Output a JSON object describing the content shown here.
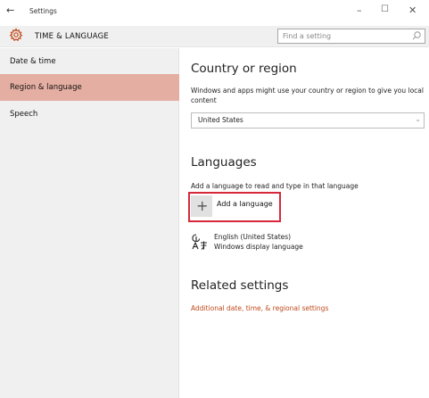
{
  "window": {
    "back_glyph": "←",
    "title": "Settings",
    "minimize_glyph": "–",
    "maximize_glyph": "☐",
    "close_glyph": "✕"
  },
  "header": {
    "icon": "gear-icon",
    "title": "TIME & LANGUAGE",
    "search_placeholder": "Find a setting",
    "search_icon": "search-icon"
  },
  "sidebar": {
    "items": [
      {
        "label": "Date & time",
        "selected": false
      },
      {
        "label": "Region & language",
        "selected": true
      },
      {
        "label": "Speech",
        "selected": false
      }
    ]
  },
  "main": {
    "country": {
      "heading": "Country or region",
      "description": "Windows and apps might use your country or region to give you local content",
      "selected": "United States",
      "chevron": "⌄"
    },
    "languages": {
      "heading": "Languages",
      "description": "Add a language to read and type in that language",
      "add_glyph": "+",
      "add_label": "Add a language",
      "items": [
        {
          "name": "English (United States)",
          "subtitle": "Windows display language",
          "icon": "language-icon"
        }
      ]
    },
    "related": {
      "heading": "Related settings",
      "link": "Additional date, time, & regional settings"
    }
  },
  "colors": {
    "accent": "#c04a1c",
    "selected_nav": "#e5aea2",
    "highlight_border": "#d7283a",
    "sidebar_bg": "#f0f0f0"
  }
}
